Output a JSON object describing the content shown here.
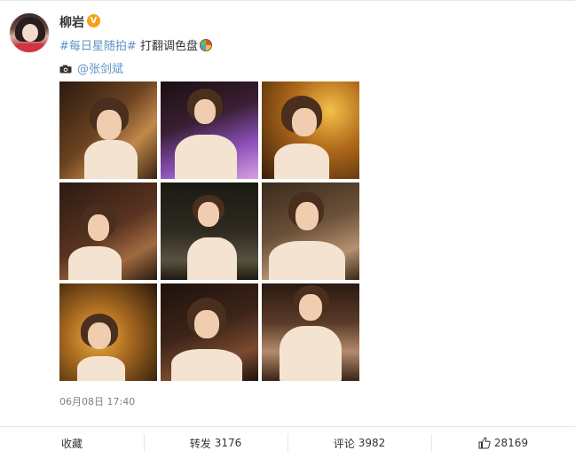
{
  "user": {
    "name": "柳岩",
    "verified_badge": "V",
    "badge_color": "#f6a015"
  },
  "post": {
    "hashtag": "#每日星随拍#",
    "text": "打翻调色盘",
    "emoji": "palette-emoji",
    "credit_icon": "camera-icon",
    "credit_mention": "@张剑斌",
    "timestamp": "06月08日 17:40",
    "photos": [
      {
        "name": "photo-1",
        "bg": "linear-gradient(135deg,#2b1a10 0%,#6a4220 45%,#c2884a 70%,#3a2414 100%)"
      },
      {
        "name": "photo-2",
        "bg": "linear-gradient(160deg,#1a0f12 0%,#3a1f33 40%,#8a4fb8 70%,#d9a0e0 100%)"
      },
      {
        "name": "photo-3",
        "bg": "radial-gradient(circle at 70% 30%,#f5c04a 0%,#b06a1a 40%,#3a1e0a 100%)"
      },
      {
        "name": "photo-4",
        "bg": "linear-gradient(150deg,#2a1a12 0%,#5a3320 50%,#a06a40 75%,#2a1a10 100%)"
      },
      {
        "name": "photo-5",
        "bg": "linear-gradient(180deg,#1a1a14 0%,#2e2a20 50%,#5a5240 80%,#1e1a12 100%)"
      },
      {
        "name": "photo-6",
        "bg": "linear-gradient(160deg,#3a2a1c 0%,#6a5038 45%,#b69070 75%,#3a2818 100%)"
      },
      {
        "name": "photo-7",
        "bg": "radial-gradient(circle at 40% 55%,#f0b040 0%,#a86a20 40%,#2a180a 100%)"
      },
      {
        "name": "photo-8",
        "bg": "linear-gradient(160deg,#1e120c 0%,#3c2418 45%,#7a4a30 75%,#1e120a 100%)"
      },
      {
        "name": "photo-9",
        "bg": "linear-gradient(180deg,#2a1a12 0%,#5a3a28 40%,#b48a6a 70%,#3a2416 100%)"
      }
    ]
  },
  "actions": {
    "favorite_label": "收藏",
    "repost_label": "转发",
    "repost_count": "3176",
    "comment_label": "评论",
    "comment_count": "3982",
    "like_icon": "thumbs-up-icon",
    "like_count": "28169"
  },
  "colors": {
    "link": "#5d93c6",
    "text": "#333333",
    "muted": "#808080",
    "divider": "#e6e6e6"
  }
}
